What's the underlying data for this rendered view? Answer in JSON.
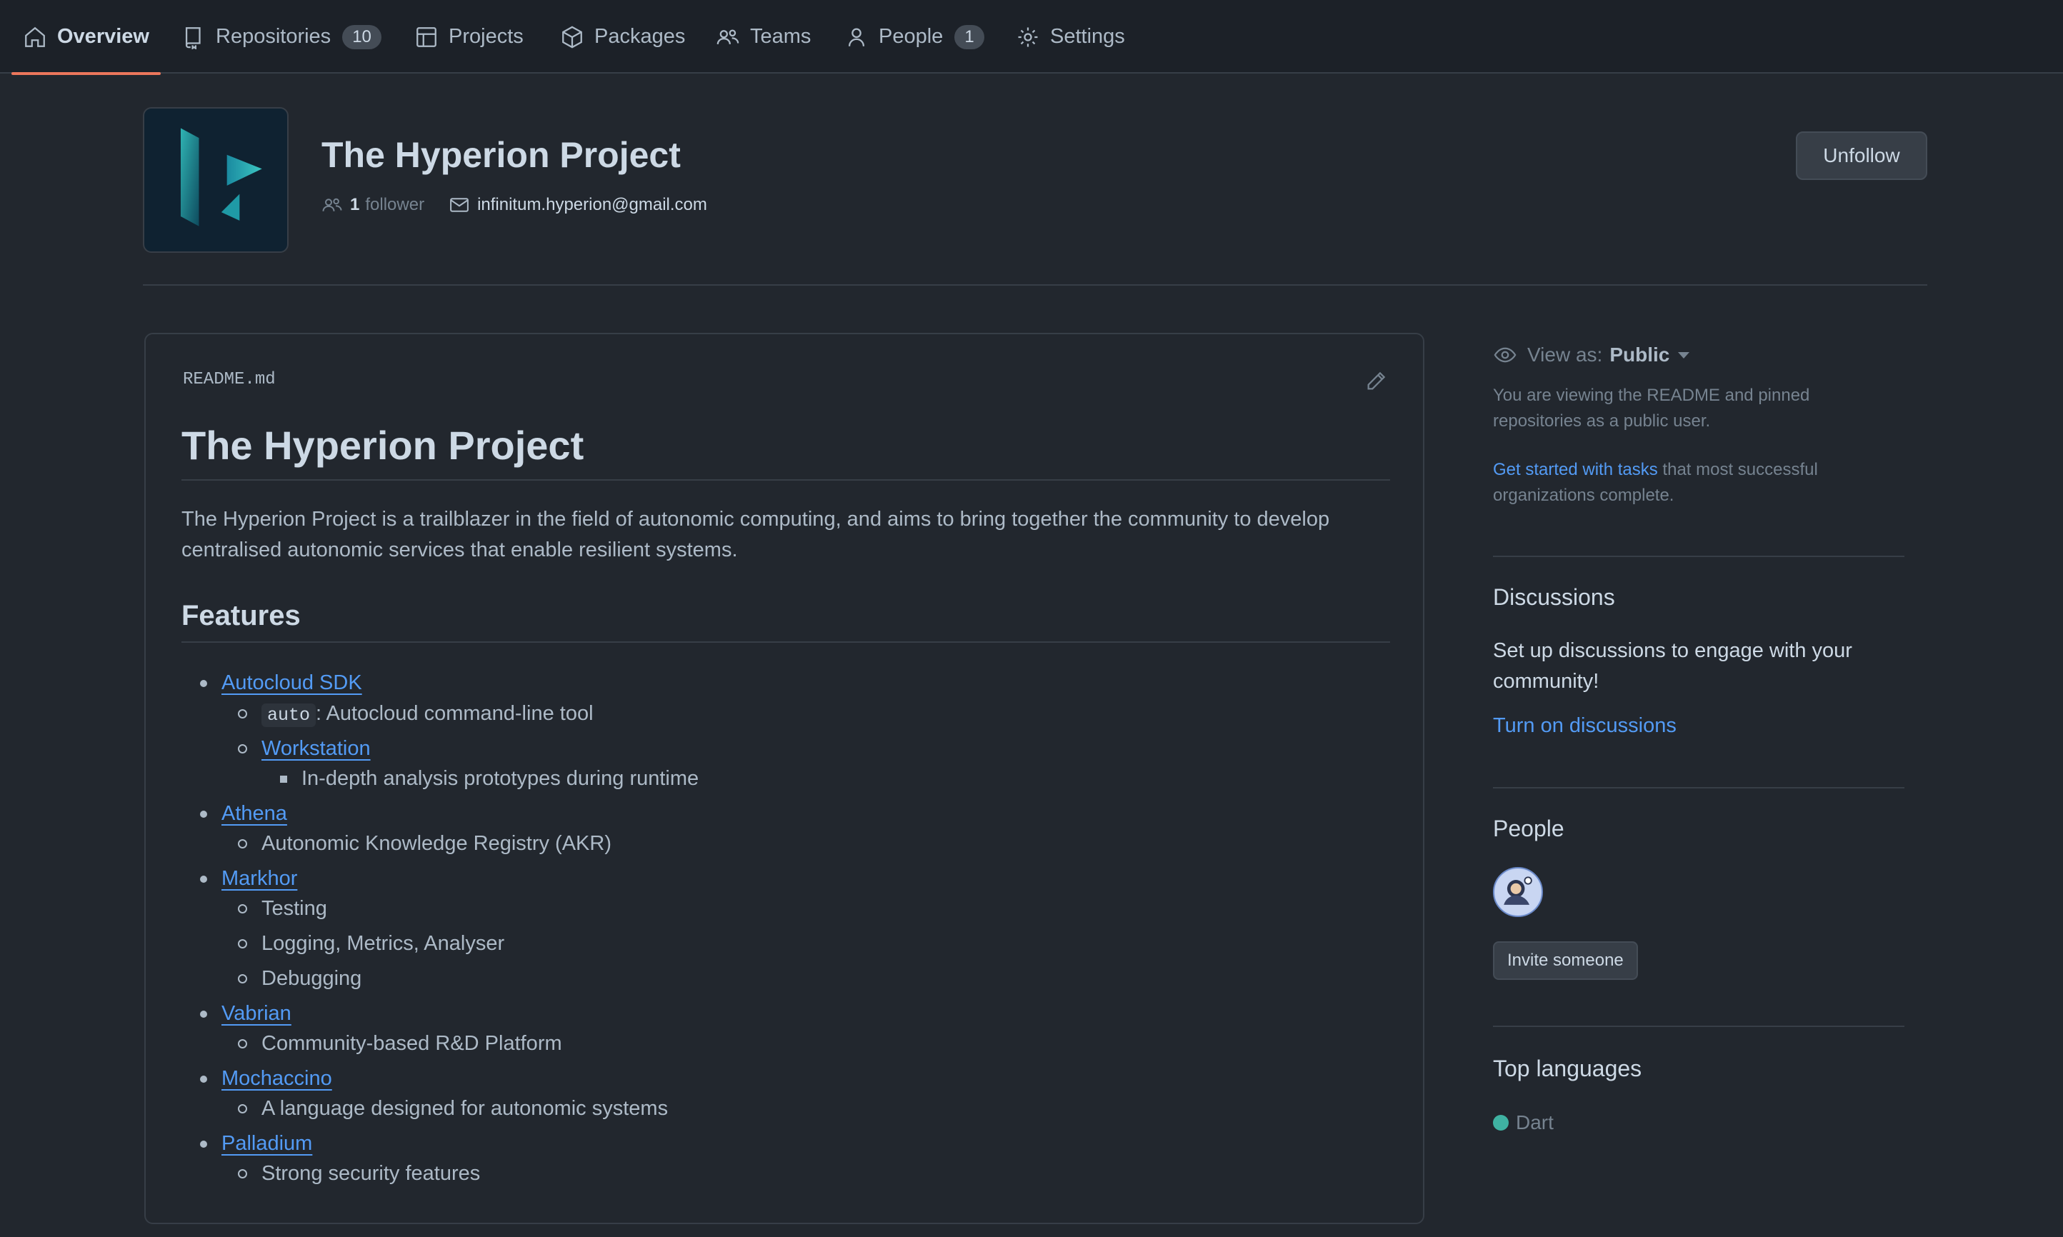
{
  "nav": {
    "tabs": [
      {
        "label": "Overview",
        "icon": "home-icon"
      },
      {
        "label": "Repositories",
        "icon": "repo-icon",
        "count": "10"
      },
      {
        "label": "Projects",
        "icon": "table-icon"
      },
      {
        "label": "Packages",
        "icon": "package-icon"
      },
      {
        "label": "Teams",
        "icon": "people-icon"
      },
      {
        "label": "People",
        "icon": "person-icon",
        "count": "1"
      },
      {
        "label": "Settings",
        "icon": "gear-icon"
      }
    ],
    "active_accent": "#ec775c"
  },
  "org": {
    "name": "The Hyperion Project",
    "followers_count": "1",
    "followers_label": "follower",
    "email": "infinitum.hyperion@gmail.com",
    "unfollow_label": "Unfollow"
  },
  "readme": {
    "filename": "README.md",
    "title": "The Hyperion Project",
    "intro": "The Hyperion Project is a trailblazer in the field of autonomic computing, and aims to bring together the community to develop centralised autonomic services that enable resilient systems.",
    "features_heading": "Features",
    "features": {
      "autocloud": "Autocloud SDK",
      "auto_code": "auto",
      "auto_desc": ": Autocloud command-line tool",
      "workstation": "Workstation",
      "workstation_desc": "In-depth analysis prototypes during runtime",
      "athena": "Athena",
      "athena_desc": "Autonomic Knowledge Registry (AKR)",
      "markhor": "Markhor",
      "markhor_1": "Testing",
      "markhor_2": "Logging, Metrics, Analyser",
      "markhor_3": "Debugging",
      "vabrian": "Vabrian",
      "vabrian_desc": "Community-based R&D Platform",
      "mochaccino": "Mochaccino",
      "mochaccino_desc": "A language designed for autonomic systems",
      "palladium": "Palladium",
      "palladium_desc": "Strong security features"
    }
  },
  "sidebar": {
    "view_as_label": "View as:",
    "view_as_value": "Public",
    "view_note": "You are viewing the README and pinned repositories as a public user.",
    "tasks_link": "Get started with tasks",
    "tasks_rest": " that most successful organizations complete.",
    "discussions_heading": "Discussions",
    "discussions_text": "Set up discussions to engage with your community!",
    "discussions_link": "Turn on discussions",
    "people_heading": "People",
    "invite_label": "Invite someone",
    "languages_heading": "Top languages",
    "language": "Dart",
    "language_color": "#3fb2a2"
  }
}
